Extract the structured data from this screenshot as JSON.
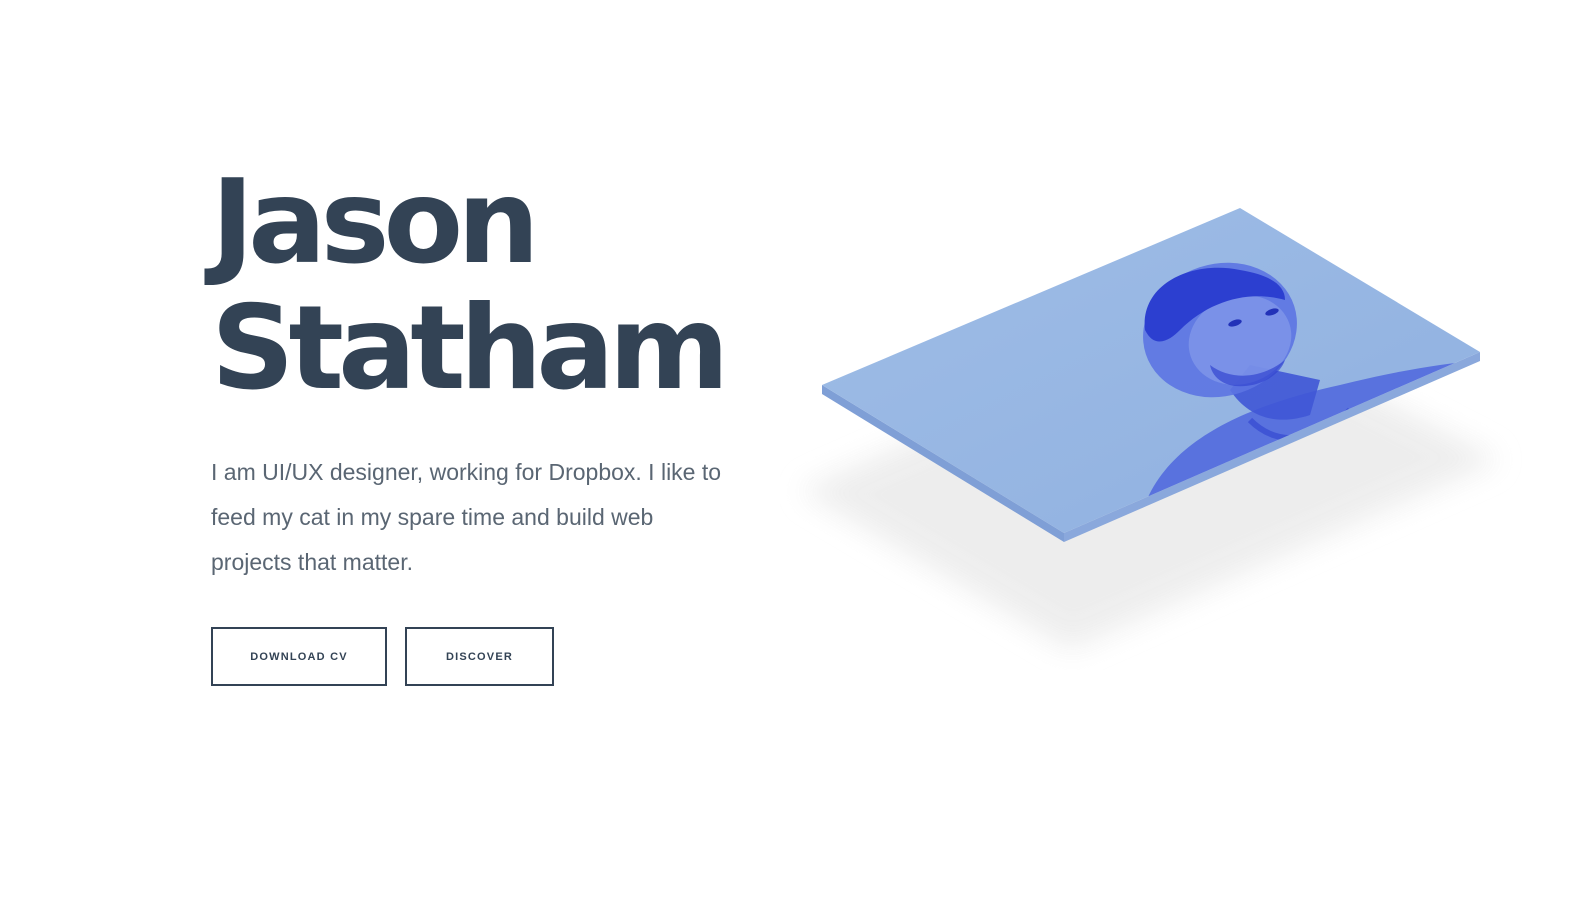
{
  "hero": {
    "first_name": "Jason",
    "last_name": "Statham",
    "bio": "I am UI/UX designer, working for Dropbox. I like to feed my cat in my spare time and build web projects that matter."
  },
  "actions": {
    "download_label": "DOWNLOAD CV",
    "discover_label": "DISCOVER"
  },
  "colors": {
    "heading": "#334355",
    "body_text": "#5a6673",
    "photo_tint": "#9bb6e0",
    "photo_accent": "#3446d8",
    "shadow": "#efefef"
  },
  "visual": {
    "icon": "isometric-portrait-card"
  }
}
